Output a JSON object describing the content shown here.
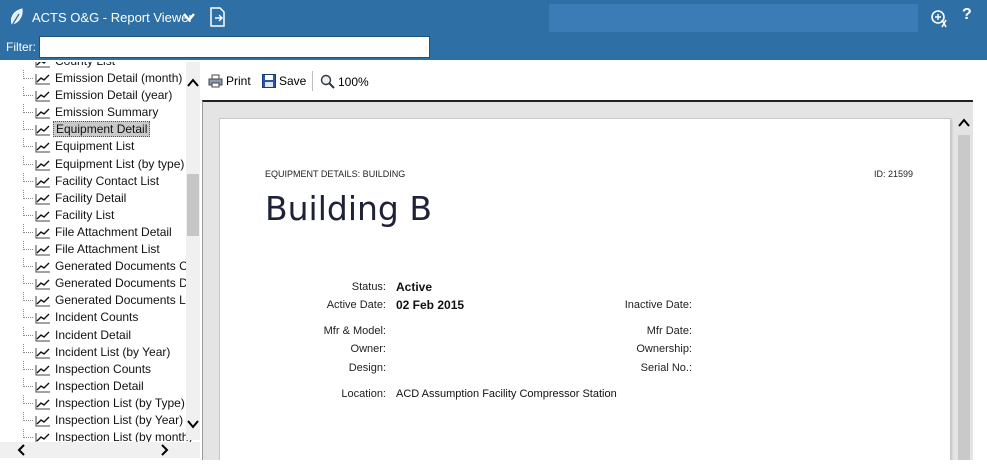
{
  "header": {
    "app_title": "ACTS O&G - Report Viewer",
    "help_label": "?"
  },
  "filter": {
    "label": "Filter:",
    "value": ""
  },
  "tree": {
    "items": [
      {
        "label": "County List",
        "selected": false
      },
      {
        "label": "Emission Detail (month)",
        "selected": false
      },
      {
        "label": "Emission Detail (year)",
        "selected": false
      },
      {
        "label": "Emission Summary",
        "selected": false
      },
      {
        "label": "Equipment Detail",
        "selected": true
      },
      {
        "label": "Equipment List",
        "selected": false
      },
      {
        "label": "Equipment List (by type)",
        "selected": false
      },
      {
        "label": "Facility Contact List",
        "selected": false
      },
      {
        "label": "Facility Detail",
        "selected": false
      },
      {
        "label": "Facility List",
        "selected": false
      },
      {
        "label": "File Attachment Detail",
        "selected": false
      },
      {
        "label": "File Attachment List",
        "selected": false
      },
      {
        "label": "Generated Documents Co",
        "selected": false
      },
      {
        "label": "Generated Documents De",
        "selected": false
      },
      {
        "label": "Generated Documents List",
        "selected": false
      },
      {
        "label": "Incident Counts",
        "selected": false
      },
      {
        "label": "Incident Detail",
        "selected": false
      },
      {
        "label": "Incident List (by Year)",
        "selected": false
      },
      {
        "label": "Inspection Counts",
        "selected": false
      },
      {
        "label": "Inspection Detail",
        "selected": false
      },
      {
        "label": "Inspection List (by Type)",
        "selected": false
      },
      {
        "label": "Inspection List (by Year)",
        "selected": false
      },
      {
        "label": "Inspection List (by month)",
        "selected": false
      }
    ]
  },
  "toolbar": {
    "print_label": "Print",
    "save_label": "Save",
    "zoom_label": "100%"
  },
  "report": {
    "category": "EQUIPMENT DETAILS: BUILDING",
    "id_text": "ID: 21599",
    "title": "Building B",
    "status_label": "Status:",
    "status_value": "Active",
    "active_date_label": "Active Date:",
    "active_date_value": "02 Feb 2015",
    "inactive_date_label": "Inactive Date:",
    "inactive_date_value": "",
    "mfr_model_label": "Mfr & Model:",
    "mfr_model_value": "",
    "mfr_date_label": "Mfr Date:",
    "mfr_date_value": "",
    "owner_label": "Owner:",
    "owner_value": "",
    "ownership_label": "Ownership:",
    "ownership_value": "",
    "design_label": "Design:",
    "design_value": "",
    "serial_label": "Serial No.:",
    "serial_value": "",
    "location_label": "Location:",
    "location_value": "ACD Assumption Facility Compressor Station"
  },
  "colors": {
    "header_bg": "#2e6fa5",
    "selection_bg": "#c9c9c9"
  }
}
